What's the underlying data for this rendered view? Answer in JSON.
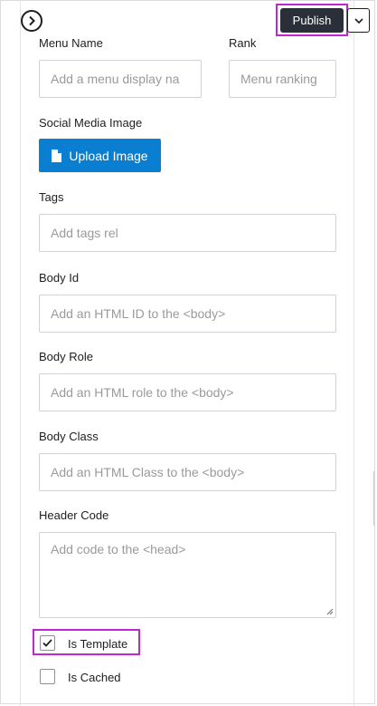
{
  "toolbar": {
    "toggle_icon": "chevron-right-circle-icon",
    "publish_label": "Publish",
    "publish_dropdown_icon": "chevron-down-icon"
  },
  "form": {
    "menu_name": {
      "label": "Menu Name",
      "placeholder": "Add a menu display na"
    },
    "rank": {
      "label": "Rank",
      "placeholder": "Menu ranking"
    },
    "social_media_image": {
      "label": "Social Media Image",
      "button_label": "Upload Image",
      "button_icon": "file-icon"
    },
    "tags": {
      "label": "Tags",
      "placeholder": "Add tags rel"
    },
    "body_id": {
      "label": "Body Id",
      "placeholder": "Add an HTML ID to the <body>"
    },
    "body_role": {
      "label": "Body Role",
      "placeholder": "Add an HTML role to the <body>"
    },
    "body_class": {
      "label": "Body Class",
      "placeholder": "Add an HTML Class to the <body>"
    },
    "header_code": {
      "label": "Header Code",
      "placeholder": "Add code to the <head>"
    },
    "is_template": {
      "label": "Is Template",
      "checked": true
    },
    "is_cached": {
      "label": "Is Cached",
      "checked": false
    }
  },
  "colors": {
    "accent": "#0a7fd1",
    "publish_bg": "#2b2f3a",
    "highlight": "#c026d3"
  }
}
